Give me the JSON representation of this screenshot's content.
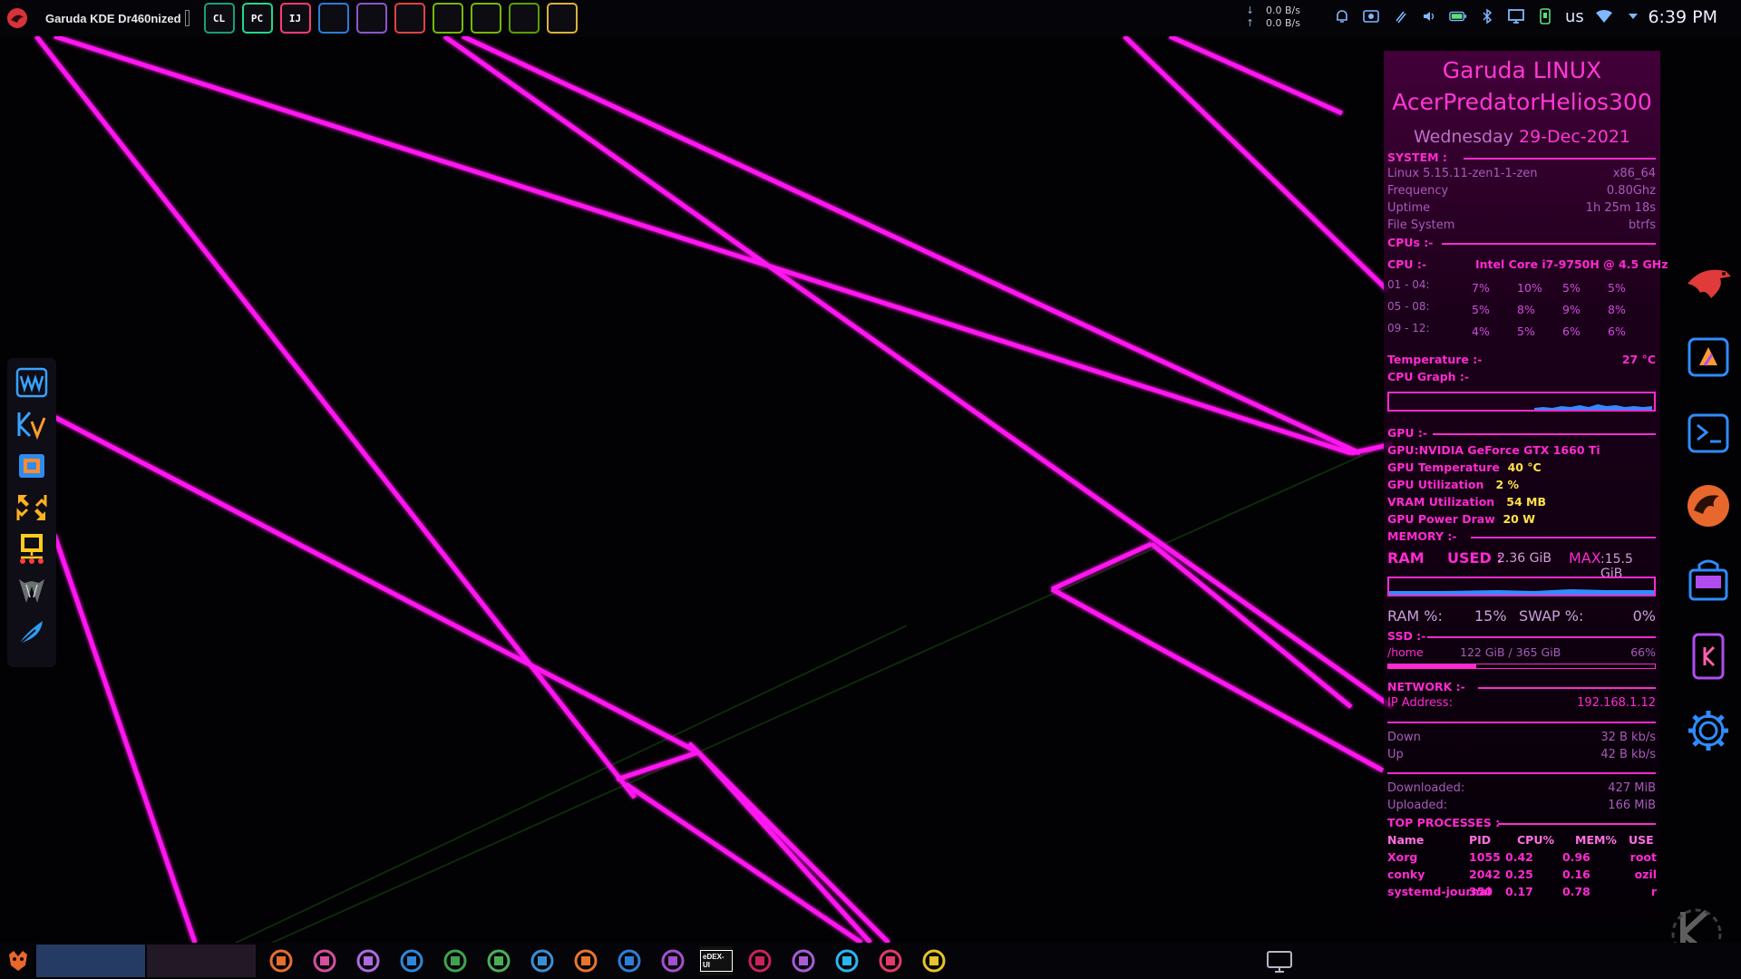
{
  "top_panel": {
    "window_title": "Garuda KDE Dr460nized",
    "launchers": [
      {
        "name": "clion-icon",
        "label": "CL",
        "color": "#1b9e77"
      },
      {
        "name": "pycharm-icon",
        "label": "PC",
        "color": "#21d789"
      },
      {
        "name": "intellij-icon",
        "label": "IJ",
        "color": "#ff3c72"
      },
      {
        "name": "vscode-icon",
        "label": "",
        "color": "#2d7cd6"
      },
      {
        "name": "github-desktop-icon",
        "label": "",
        "color": "#8d56c9"
      },
      {
        "name": "speedtest-icon",
        "label": "",
        "color": "#e24340"
      },
      {
        "name": "nvidia-settings-icon",
        "label": "",
        "color": "#76b900"
      },
      {
        "name": "nvidia-icon",
        "label": "",
        "color": "#76b900"
      },
      {
        "name": "nvidia-app-icon",
        "label": "",
        "color": "#5aa000"
      },
      {
        "name": "mail-package-icon",
        "label": "",
        "color": "#d9b23b"
      }
    ],
    "net_down": "0.0 B/s",
    "net_up": "0.0 B/s",
    "keyboard_layout": "us",
    "clock": "6:39 PM"
  },
  "conky": {
    "distro": "Garuda LINUX",
    "hostname": "AcerPredatorHelios300",
    "date_day": "Wednesday",
    "date": "29-Dec-2021",
    "system_header": "SYSTEM :",
    "kernel": "Linux 5.15.11-zen1-1-zen",
    "arch": "x86_64",
    "freq_label": "Frequency",
    "freq_value": "0.80Ghz",
    "uptime_label": "Uptime",
    "uptime_value": "1h 25m 18s",
    "fs_label": "File System",
    "fs_value": "btrfs",
    "cpus_header": "CPUs :-",
    "cpu_label": "CPU :-",
    "cpu_model": "Intel Core i7-9750H @ 4.5 GHz",
    "core_rows": [
      {
        "label": "01 - 04:",
        "values": [
          "7%",
          "10%",
          "5%",
          "5%"
        ]
      },
      {
        "label": "05 - 08:",
        "values": [
          "5%",
          "8%",
          "9%",
          "8%"
        ]
      },
      {
        "label": "09 - 12:",
        "values": [
          "4%",
          "5%",
          "6%",
          "6%"
        ]
      }
    ],
    "temp_label": "Temperature :-",
    "temp_value": "27 °C",
    "cpu_graph_label": "CPU Graph :-",
    "gpu_header": "GPU :-",
    "gpu_model": "GPU:NVIDIA GeForce GTX 1660 Ti",
    "gpu_temp_label": "GPU Temperature",
    "gpu_temp_value": "40 °C",
    "gpu_util_label": "GPU Utilization",
    "gpu_util_value": "2 %",
    "vram_label": "VRAM Utilization",
    "vram_value": "54 MB",
    "gpu_power_label": "GPU Power Draw",
    "gpu_power_value": "20 W",
    "memory_header": "MEMORY :-",
    "ram_label": "RAM",
    "used_label": "USED :",
    "used_value": "2.36 GiB",
    "max_label": "MAX",
    "max_value": ":15.5 GiB",
    "ram_pct_label": "RAM %:",
    "ram_pct_value": "15%",
    "swap_label": "SWAP %:",
    "swap_value": "0%",
    "ssd_header": "SSD :-",
    "home_label": "/home",
    "home_usage": "122 GiB / 365 GiB",
    "home_pct": "66%",
    "home_fill": 0.33,
    "network_header": "NETWORK :-",
    "ip_label": "IP Address:",
    "ip_value": "192.168.1.12",
    "down_label": "Down",
    "down_value": "32 B kb/s",
    "up_label": "Up",
    "up_value": "42 B kb/s",
    "downloaded_label": "Downloaded:",
    "downloaded_value": "427 MiB",
    "uploaded_label": "Uploaded:",
    "uploaded_value": "166 MiB",
    "processes_header": "TOP PROCESSES :-",
    "proc_headers": [
      "Name",
      "PID",
      "CPU%",
      "MEM%",
      "USE"
    ],
    "processes": [
      {
        "name": "Xorg",
        "pid": "1055",
        "cpu": "0.42",
        "mem": "0.96",
        "user": "root"
      },
      {
        "name": "conky",
        "pid": "2042",
        "cpu": "0.25",
        "mem": "0.16",
        "user": "ozil"
      },
      {
        "name": "systemd-journal",
        "pid": "350",
        "cpu": "0.17",
        "mem": "0.78",
        "user": "r"
      }
    ]
  },
  "left_dock": [
    "wavemon-icon",
    "kvantum-icon",
    "virtualbox-icon",
    "fullscreen-tool-icon",
    "network-tool-icon",
    "predator-sense-icon",
    "feather-app-icon"
  ],
  "right_dock": [
    "garuda-eagle-icon",
    "discover-app-icon",
    "terminal-icon",
    "garuda-dragon-icon",
    "store-bag-icon",
    "kde-connect-icon",
    "settings-gear-icon"
  ],
  "bottom_bar": {
    "icons": [
      {
        "name": "file-manager-icon",
        "color": "#e76f2c",
        "text": ""
      },
      {
        "name": "chrome-icon",
        "color": "#d44fa0",
        "text": ""
      },
      {
        "name": "discord-icon",
        "color": "#b06ae0",
        "text": ""
      },
      {
        "name": "video-call-icon",
        "color": "#2f86d8",
        "text": ""
      },
      {
        "name": "qbittorrent-icon",
        "color": "#3fa34d",
        "text": ""
      },
      {
        "name": "usb-writer-icon",
        "color": "#4bb055",
        "text": ""
      },
      {
        "name": "phone-manager-icon",
        "color": "#3a8fd4",
        "text": ""
      },
      {
        "name": "disk-usage-icon",
        "color": "#e8762c",
        "text": ""
      },
      {
        "name": "teamviewer-icon",
        "color": "#2e7ed6",
        "text": ""
      },
      {
        "name": "obs-icon",
        "color": "#a64ed1",
        "text": ""
      },
      {
        "name": "edex-ui-icon",
        "color": "#ffffff",
        "text": "eDEX-UI"
      },
      {
        "name": "raspberry-pi-icon",
        "color": "#c8245a",
        "text": ""
      },
      {
        "name": "drawing-icon",
        "color": "#a95bd6",
        "text": ""
      },
      {
        "name": "send-anywhere-icon",
        "color": "#2bb6f0",
        "text": ""
      },
      {
        "name": "tool-app-icon",
        "color": "#e23a6a",
        "text": ""
      },
      {
        "name": "pineapple-icon",
        "color": "#e7c32c",
        "text": ""
      }
    ]
  },
  "colors": {
    "accent": "#ff2ad0",
    "wallpaper_line": "#ff00ff",
    "panel": "#050409"
  }
}
